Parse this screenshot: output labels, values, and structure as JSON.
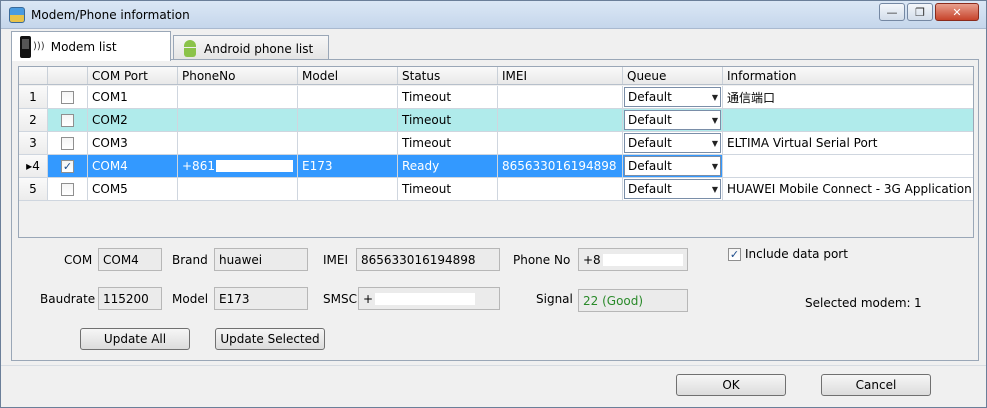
{
  "window": {
    "title": "Modem/Phone information",
    "min_glyph": "—",
    "max_glyph": "❐",
    "close_glyph": "✕"
  },
  "tabs": [
    {
      "label": "Modem list",
      "active": true
    },
    {
      "label": "Android phone list",
      "active": false
    }
  ],
  "grid": {
    "columns": [
      "COM Port",
      "PhoneNo",
      "Model",
      "Status",
      "IMEI",
      "Queue",
      "Information"
    ],
    "rows": [
      {
        "index": "1",
        "marker": "",
        "checked": false,
        "com": "COM1",
        "phone": "",
        "model": "",
        "status": "Timeout",
        "imei": "",
        "queue": "Default",
        "info": "通信端口"
      },
      {
        "index": "2",
        "marker": "",
        "checked": false,
        "com": "COM2",
        "phone": "",
        "model": "",
        "status": "Timeout",
        "imei": "",
        "queue": "Default",
        "info": ""
      },
      {
        "index": "3",
        "marker": "",
        "checked": false,
        "com": "COM3",
        "phone": "",
        "model": "",
        "status": "Timeout",
        "imei": "",
        "queue": "Default",
        "info": "ELTIMA Virtual Serial Port"
      },
      {
        "index": "4",
        "marker": "▸",
        "checked": true,
        "com": "COM4",
        "phone": "+861",
        "model": "E173",
        "status": "Ready",
        "imei": "865633016194898",
        "queue": "Default",
        "info": ""
      },
      {
        "index": "5",
        "marker": "",
        "checked": false,
        "com": "COM5",
        "phone": "",
        "model": "",
        "status": "Timeout",
        "imei": "",
        "queue": "Default",
        "info": "HUAWEI Mobile Connect - 3G Application ..."
      }
    ]
  },
  "details": {
    "com_label": "COM",
    "com_value": "COM4",
    "brand_label": "Brand",
    "brand_value": "huawei",
    "imei_label": "IMEI",
    "imei_value": "865633016194898",
    "phone_label": "Phone No",
    "phone_value": "+8",
    "baud_label": "Baudrate",
    "baud_value": "115200",
    "model_label": "Model",
    "model_value": "E173",
    "smsc_label": "SMSC",
    "smsc_value": "+",
    "signal_label": "Signal",
    "signal_value": "22 (Good)",
    "include_label": "Include data port",
    "selected_label": "Selected modem:",
    "selected_value": "1"
  },
  "buttons": {
    "update_all": "Update All",
    "update_selected": "Update Selected",
    "ok": "OK",
    "cancel": "Cancel"
  },
  "check_glyph": "✓"
}
